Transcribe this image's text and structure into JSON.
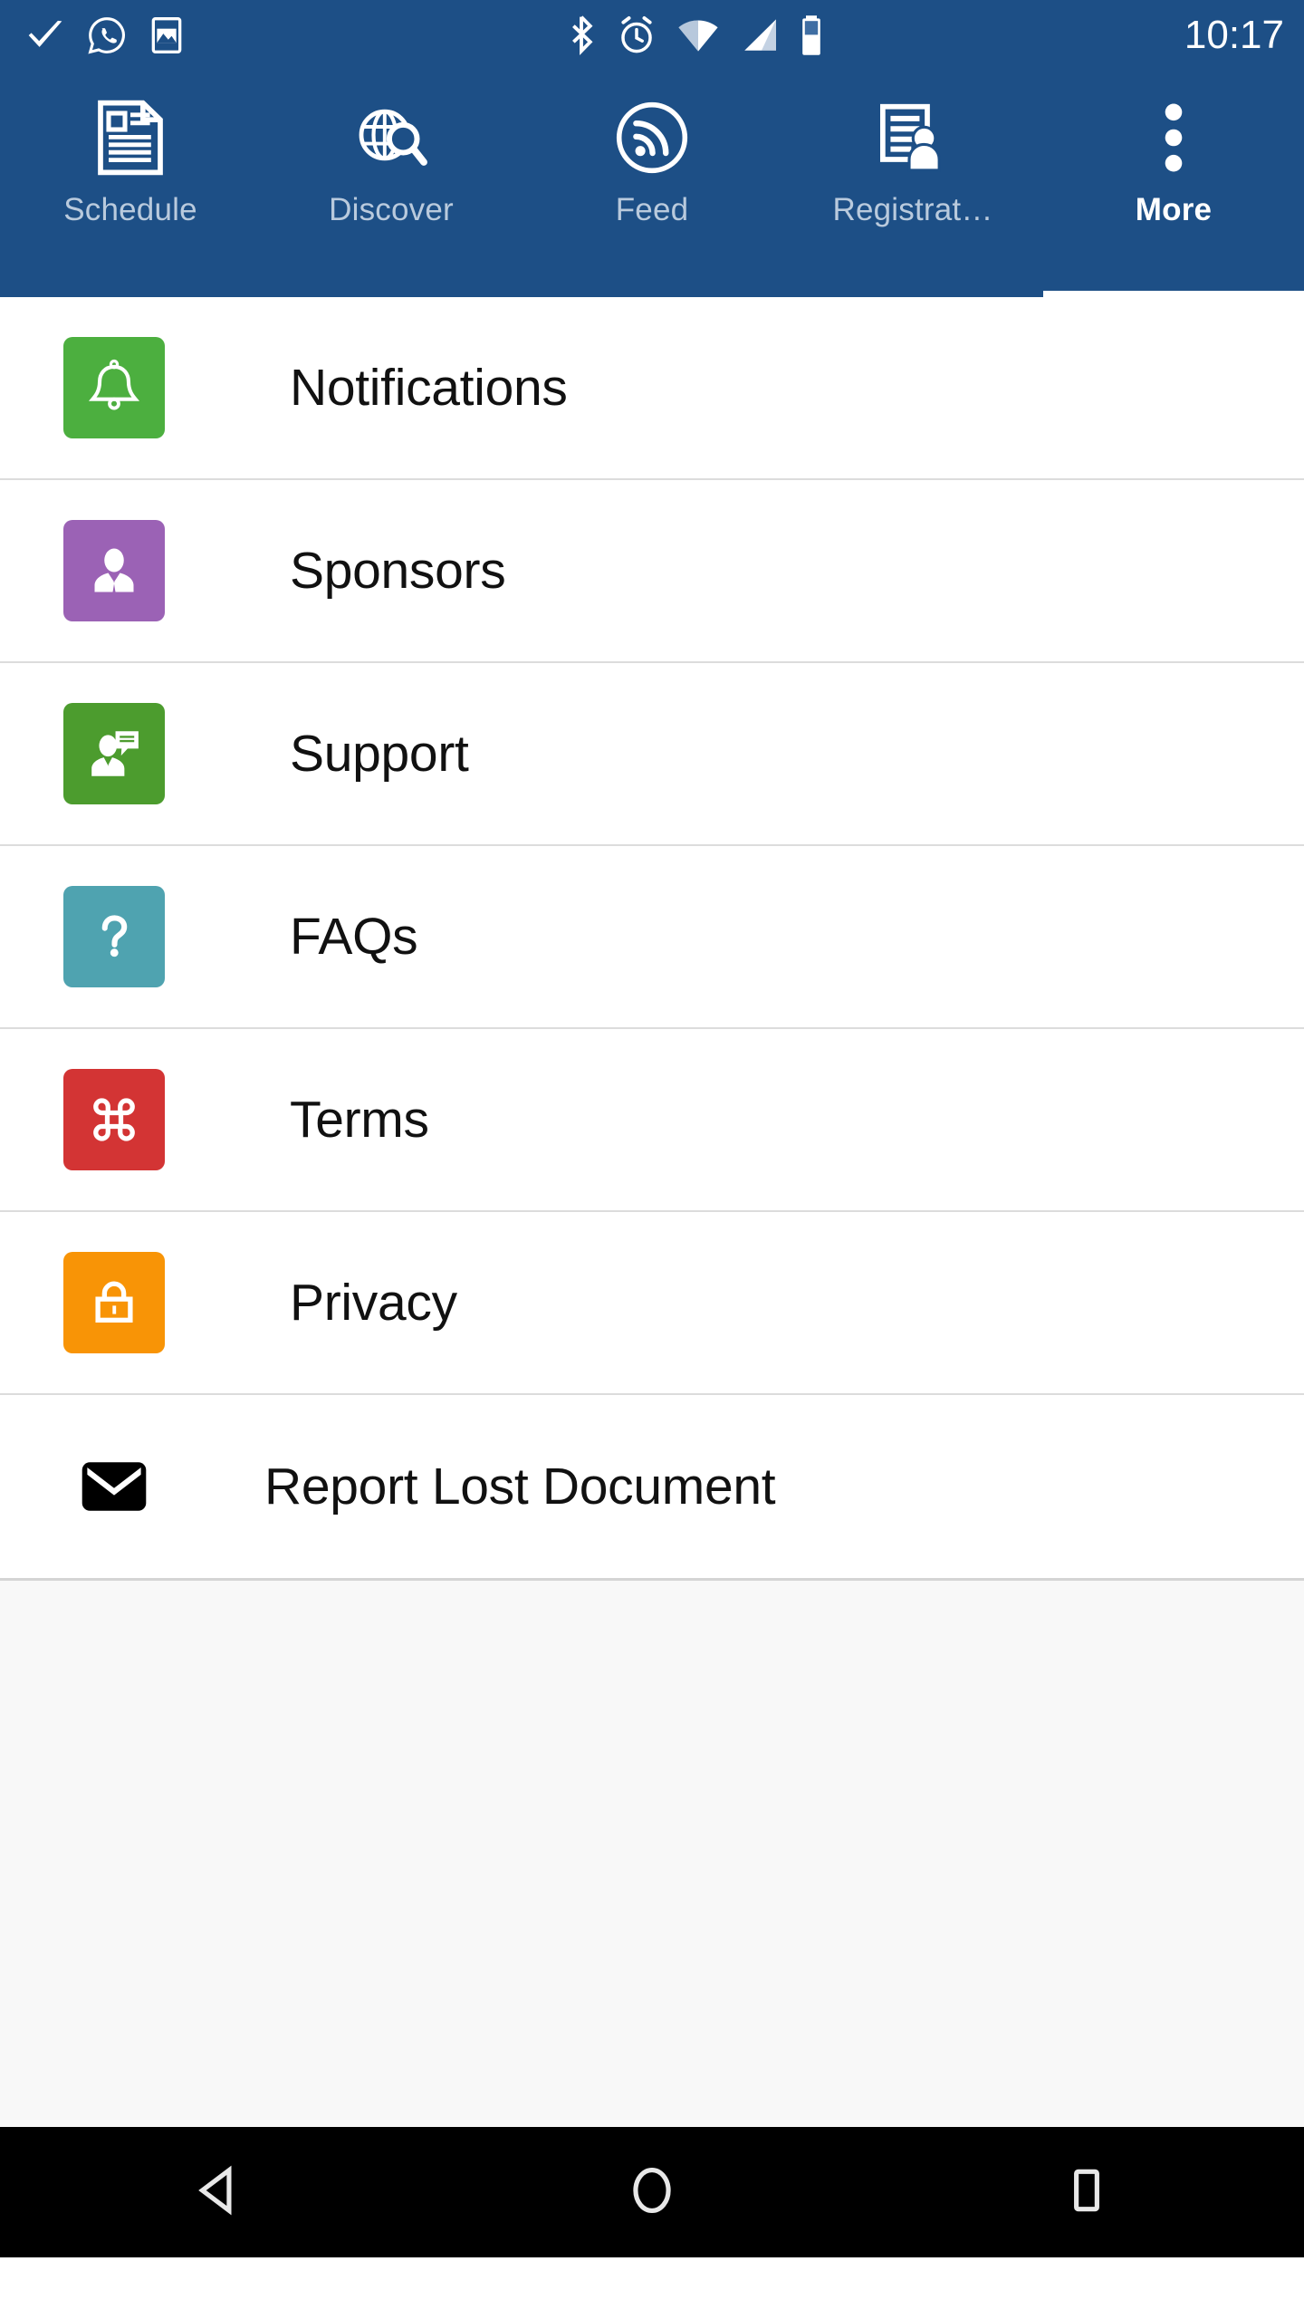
{
  "status_bar": {
    "time": "10:17",
    "left_icons": [
      "checkmark-icon",
      "whatsapp-icon",
      "screenshot-image-icon"
    ],
    "right_icons": [
      "bluetooth-icon",
      "alarm-icon",
      "wifi-icon",
      "cellular-signal-icon",
      "battery-icon"
    ],
    "background_color": "#1d4f86"
  },
  "tab_bar": {
    "background_color": "#1d4f86",
    "active_tab_index": 4,
    "active_color": "#ffffff",
    "inactive_color": "#b9cadd",
    "tabs": [
      {
        "label": "Schedule",
        "icon": "document-lines-icon"
      },
      {
        "label": "Discover",
        "icon": "globe-search-icon"
      },
      {
        "label": "Feed",
        "icon": "rss-circle-icon"
      },
      {
        "label": "Registrat…",
        "icon": "registration-person-document-icon"
      },
      {
        "label": "More",
        "icon": "more-vertical-dots-icon"
      }
    ]
  },
  "list": {
    "items": [
      {
        "label": "Notifications",
        "icon": "bell-icon",
        "tile_color": "#4caf3f",
        "tile": true
      },
      {
        "label": "Sponsors",
        "icon": "person-suit-icon",
        "tile_color": "#9b62b5",
        "tile": true
      },
      {
        "label": "Support",
        "icon": "person-chat-icon",
        "tile_color": "#4c9c2e",
        "tile": true
      },
      {
        "label": "FAQs",
        "icon": "question-mark-icon",
        "tile_color": "#4fa3b0",
        "tile": true
      },
      {
        "label": "Terms",
        "icon": "command-loop-icon",
        "tile_color": "#d33434",
        "tile": true
      },
      {
        "label": "Privacy",
        "icon": "lock-icon",
        "tile_color": "#f89406",
        "tile": true
      },
      {
        "label": "Report Lost Document",
        "icon": "envelope-icon",
        "tile_color": "#000000",
        "tile": false
      }
    ]
  },
  "nav_bar": {
    "background_color": "#000000",
    "buttons": [
      {
        "name": "back-button",
        "icon": "back-triangle-icon"
      },
      {
        "name": "home-button",
        "icon": "home-circle-icon"
      },
      {
        "name": "recents-button",
        "icon": "recents-square-icon"
      }
    ]
  },
  "page_background_color": "#f8f8f8"
}
